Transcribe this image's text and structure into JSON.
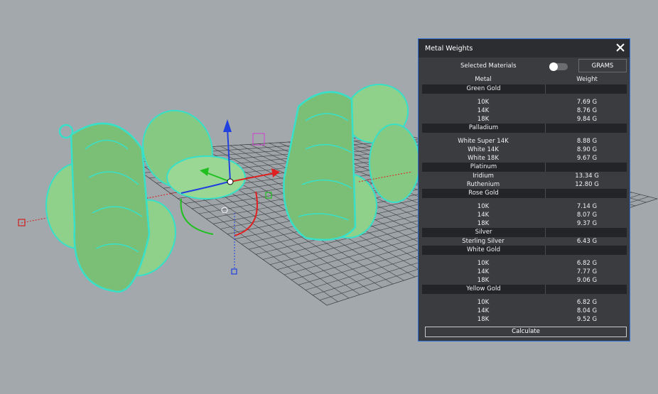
{
  "panel": {
    "title": "Metal Weights",
    "selected_materials_label": "Selected Materials",
    "toggle_on": false,
    "units_button": "GRAMS",
    "col_metal": "Metal",
    "col_weight": "Weight",
    "calculate_label": "Calculate",
    "groups": [
      {
        "name": "Green Gold",
        "items": [
          {
            "metal": "10K",
            "weight": "7.69 G"
          },
          {
            "metal": "14K",
            "weight": "8.76 G"
          },
          {
            "metal": "18K",
            "weight": "9.84 G"
          }
        ]
      },
      {
        "name": "Palladium",
        "items": [
          {
            "metal": "White Super 14K",
            "weight": "8.88 G"
          },
          {
            "metal": "White 14K",
            "weight": "8.90 G"
          },
          {
            "metal": "White 18K",
            "weight": "9.67 G"
          }
        ]
      },
      {
        "name": "Platinum",
        "items": [
          {
            "metal": "Iridium",
            "weight": "13.34 G"
          },
          {
            "metal": "Ruthenium",
            "weight": "12.80 G"
          }
        ]
      },
      {
        "name": "Rose Gold",
        "items": [
          {
            "metal": "10K",
            "weight": "7.14 G"
          },
          {
            "metal": "14K",
            "weight": "8.07 G"
          },
          {
            "metal": "18K",
            "weight": "9.37 G"
          }
        ]
      },
      {
        "name": "Silver",
        "items": [
          {
            "metal": "Sterling Silver",
            "weight": "6.43 G"
          }
        ]
      },
      {
        "name": "White Gold",
        "items": [
          {
            "metal": "10K",
            "weight": "6.82 G"
          },
          {
            "metal": "14K",
            "weight": "7.77 G"
          },
          {
            "metal": "18K",
            "weight": "9.06 G"
          }
        ]
      },
      {
        "name": "Yellow Gold",
        "items": [
          {
            "metal": "10K",
            "weight": "6.82 G"
          },
          {
            "metal": "14K",
            "weight": "8.04 G"
          },
          {
            "metal": "18K",
            "weight": "9.52 G"
          }
        ]
      }
    ]
  },
  "colors": {
    "viewport_bg": "#a3a8ad",
    "panel_bg": "#3b3c40",
    "panel_border": "#2b6fd6",
    "object_fill": "#8fd08a",
    "object_wire": "#37e0c8",
    "axis_x": "#e02020",
    "axis_y": "#20c020",
    "axis_z": "#2040e0"
  },
  "viewport": {
    "objects": [
      "pendant-left",
      "pendant-right"
    ]
  }
}
